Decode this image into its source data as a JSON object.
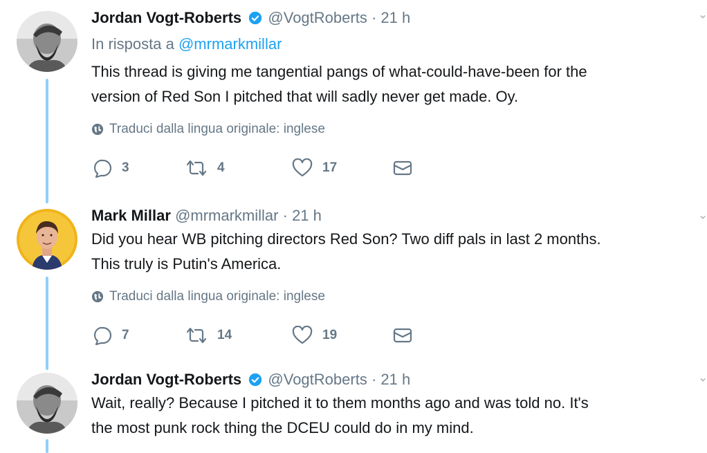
{
  "tweets": [
    {
      "name": "Jordan Vogt-Roberts",
      "verified": true,
      "handle": "@VogtRoberts",
      "time": "· 21 h",
      "reply_prefix": "In risposta a",
      "reply_mention": "@mrmarkmillar",
      "text_lines": [
        "This thread is giving me tangential pangs of what-could-have-been for the",
        "version of Red Son I pitched that will sadly never get made. Oy."
      ],
      "translate_label": "Traduci dalla lingua originale: inglese",
      "replies": "3",
      "retweets": "4",
      "likes": "17"
    },
    {
      "name": "Mark Millar",
      "verified": false,
      "handle": "@mrmarkmillar",
      "time": "· 21 h",
      "text_lines": [
        "Did you hear WB pitching directors Red Son? Two diff pals in last 2 months.",
        "This truly is Putin's America."
      ],
      "translate_label": "Traduci dalla lingua originale: inglese",
      "replies": "7",
      "retweets": "14",
      "likes": "19"
    },
    {
      "name": "Jordan Vogt-Roberts",
      "verified": true,
      "handle": "@VogtRoberts",
      "time": "· 21 h",
      "text_lines": [
        "Wait, really? Because I pitched it to them months ago and was told no. It's",
        "the most punk rock thing the DCEU could do in my mind."
      ]
    }
  ],
  "colors": {
    "accent": "#1da1f2",
    "secondary_text": "#657786",
    "thread_line": "#8fd0f7"
  },
  "icons": [
    "globe-icon",
    "reply-icon",
    "retweet-icon",
    "like-icon",
    "message-icon",
    "verified-icon",
    "chevron-down-icon"
  ]
}
